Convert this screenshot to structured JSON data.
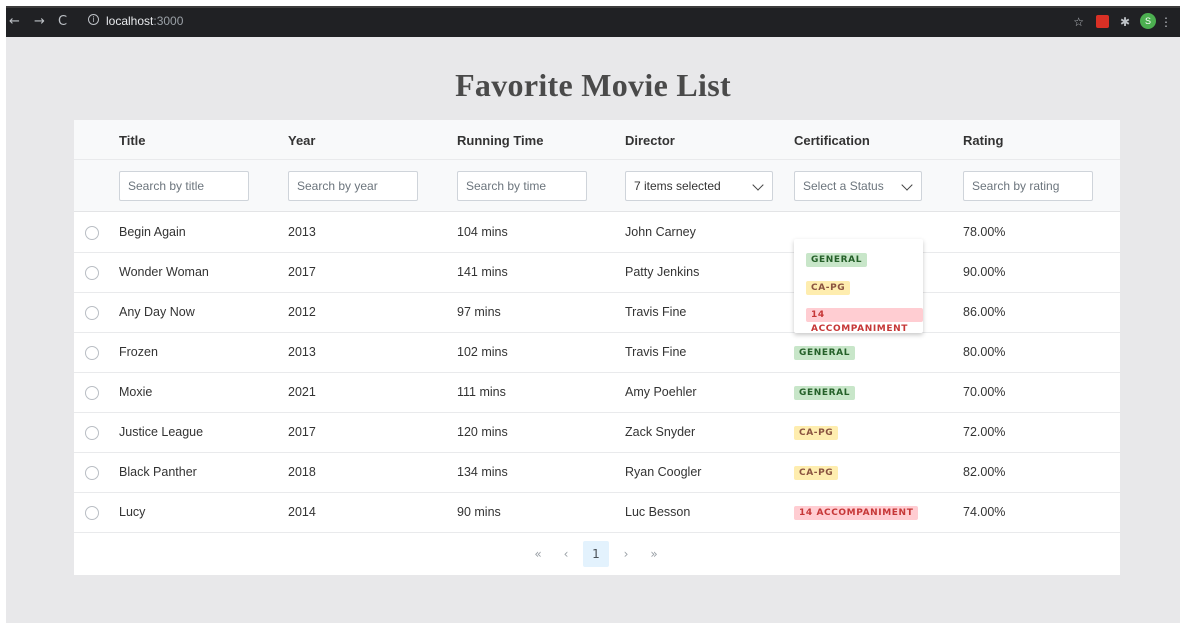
{
  "browser": {
    "url_host": "localhost",
    "url_port": ":3000"
  },
  "page": {
    "title": "Favorite Movie List"
  },
  "table": {
    "columns": [
      "Title",
      "Year",
      "Running Time",
      "Director",
      "Certification",
      "Rating"
    ],
    "filters": {
      "title_placeholder": "Search by title",
      "year_placeholder": "Search by year",
      "time_placeholder": "Search by time",
      "director_selected": "7 items selected",
      "cert_placeholder": "Select a Status",
      "rating_placeholder": "Search by rating"
    },
    "rows": [
      {
        "title": "Begin Again",
        "year": "2013",
        "time": "104 mins",
        "director": "John Carney",
        "cert": "",
        "rating": "78.00%"
      },
      {
        "title": "Wonder Woman",
        "year": "2017",
        "time": "141 mins",
        "director": "Patty Jenkins",
        "cert": "",
        "rating": "90.00%"
      },
      {
        "title": "Any Day Now",
        "year": "2012",
        "time": "97 mins",
        "director": "Travis Fine",
        "cert": "14 ACCOMPANIMENT",
        "rating": "86.00%"
      },
      {
        "title": "Frozen",
        "year": "2013",
        "time": "102 mins",
        "director": "Travis Fine",
        "cert": "GENERAL",
        "rating": "80.00%"
      },
      {
        "title": "Moxie",
        "year": "2021",
        "time": "111 mins",
        "director": "Amy Poehler",
        "cert": "GENERAL",
        "rating": "70.00%"
      },
      {
        "title": "Justice League",
        "year": "2017",
        "time": "120 mins",
        "director": "Zack Snyder",
        "cert": "CA-PG",
        "rating": "72.00%"
      },
      {
        "title": "Black Panther",
        "year": "2018",
        "time": "134 mins",
        "director": "Ryan Coogler",
        "cert": "CA-PG",
        "rating": "82.00%"
      },
      {
        "title": "Lucy",
        "year": "2014",
        "time": "90 mins",
        "director": "Luc Besson",
        "cert": "14 ACCOMPANIMENT",
        "rating": "74.00%"
      }
    ]
  },
  "dropdown": {
    "options": [
      "GENERAL",
      "CA-PG",
      "14 ACCOMPANIMENT"
    ]
  },
  "pagination": {
    "first": "«",
    "prev": "‹",
    "current": "1",
    "next": "›",
    "last": "»"
  },
  "colors": {
    "general_bg": "#c8e6c9",
    "capg_bg": "#feedaf",
    "accompaniment_bg": "#ffcdd2",
    "page_bg": "#e8e8ea"
  }
}
